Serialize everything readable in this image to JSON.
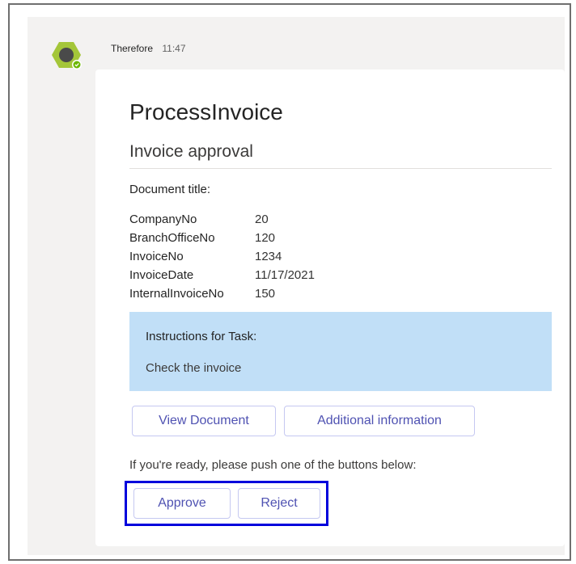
{
  "message": {
    "sender": "Therefore",
    "time": "11:47"
  },
  "card": {
    "title": "ProcessInvoice",
    "subtitle": "Invoice approval",
    "document_title_label": "Document title:",
    "fields": [
      {
        "name": "CompanyNo",
        "value": "20"
      },
      {
        "name": "BranchOfficeNo",
        "value": "120"
      },
      {
        "name": "InvoiceNo",
        "value": "1234"
      },
      {
        "name": "InvoiceDate",
        "value": "11/17/2021"
      },
      {
        "name": "InternalInvoiceNo",
        "value": "150"
      }
    ],
    "instructions": {
      "title": "Instructions for Task:",
      "text": "Check the invoice"
    },
    "buttons": {
      "view_document": "View Document",
      "additional_information": "Additional information",
      "approve": "Approve",
      "reject": "Reject"
    },
    "prompt": "If you're ready, please push one of the buttons below:"
  },
  "colors": {
    "button_text": "#4f52b2",
    "instructions_background": "#c1dff7",
    "highlight_border": "#0000dc",
    "avatar_hex": "#a4c639",
    "presence_available": "#6bb700"
  },
  "icons": {
    "avatar": "hexagon-avatar-icon",
    "presence": "available-status-icon"
  }
}
